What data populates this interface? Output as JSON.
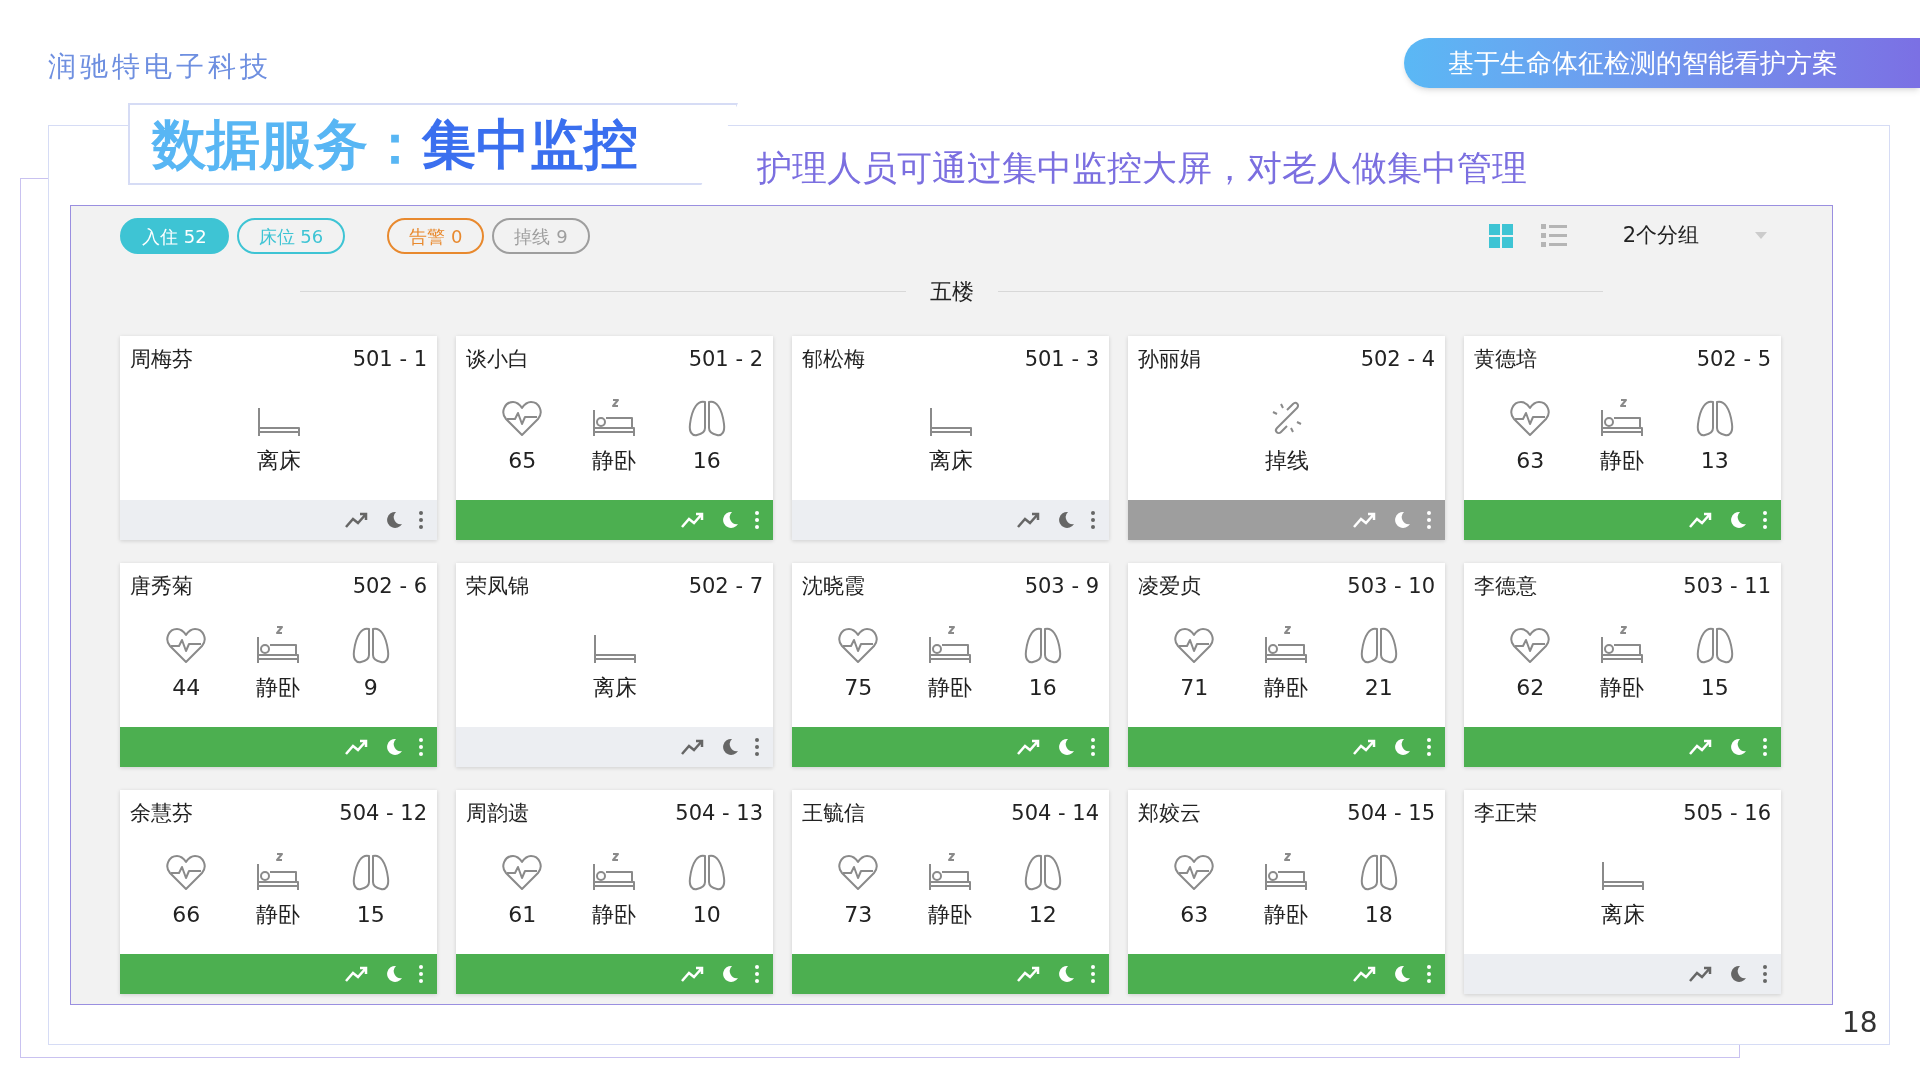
{
  "company": "润驰特电子科技",
  "banner": "基于生命体征检测的智能看护方案",
  "title": {
    "part_1": "数据服务：",
    "part_2": "集中监控"
  },
  "subtitle": "护理人员可通过集中监控大屏，对老人做集中管理",
  "filters": [
    {
      "label": "入住 52",
      "selected": true,
      "color": "#3ec4d4"
    },
    {
      "label": "床位 56",
      "selected": false,
      "color": "#3ec4d4"
    },
    {
      "label": "告警 0",
      "selected": false,
      "color": "#e8892e"
    },
    {
      "label": "掉线 9",
      "selected": false,
      "color": "#9e9e9e"
    }
  ],
  "views": [
    {
      "kind": "grid",
      "selected": true
    },
    {
      "kind": "list",
      "selected": false
    }
  ],
  "group_select": "2个分组",
  "floor": "五楼",
  "cards": [
    {
      "name": "周梅芬",
      "bed": "501 - 1",
      "kind": "off_bed",
      "label": "离床"
    },
    {
      "name": "谈小白",
      "bed": "501 - 2",
      "kind": "resting",
      "heart_rate": "65",
      "label": "静卧",
      "breath": "16"
    },
    {
      "name": "郁松梅",
      "bed": "501 - 3",
      "kind": "off_bed",
      "label": "离床"
    },
    {
      "name": "孙丽娟",
      "bed": "502 - 4",
      "kind": "offline",
      "label": "掉线"
    },
    {
      "name": "黄德培",
      "bed": "502 - 5",
      "kind": "resting",
      "heart_rate": "63",
      "label": "静卧",
      "breath": "13"
    },
    {
      "name": "唐秀菊",
      "bed": "502 - 6",
      "kind": "resting",
      "heart_rate": "44",
      "label": "静卧",
      "breath": "9"
    },
    {
      "name": "荣凤锦",
      "bed": "502 - 7",
      "kind": "off_bed",
      "label": "离床"
    },
    {
      "name": "沈晓霞",
      "bed": "503 - 9",
      "kind": "resting",
      "heart_rate": "75",
      "label": "静卧",
      "breath": "16"
    },
    {
      "name": "凌爱贞",
      "bed": "503 - 10",
      "kind": "resting",
      "heart_rate": "71",
      "label": "静卧",
      "breath": "21"
    },
    {
      "name": "李德意",
      "bed": "503 - 11",
      "kind": "resting",
      "heart_rate": "62",
      "label": "静卧",
      "breath": "15"
    },
    {
      "name": "余慧芬",
      "bed": "504 - 12",
      "kind": "resting",
      "heart_rate": "66",
      "label": "静卧",
      "breath": "15"
    },
    {
      "name": "周韵遗",
      "bed": "504 - 13",
      "kind": "resting",
      "heart_rate": "61",
      "label": "静卧",
      "breath": "10"
    },
    {
      "name": "王毓信",
      "bed": "504 - 14",
      "kind": "resting",
      "heart_rate": "73",
      "label": "静卧",
      "breath": "12"
    },
    {
      "name": "郑姣云",
      "bed": "504 - 15",
      "kind": "resting",
      "heart_rate": "63",
      "label": "静卧",
      "breath": "18"
    },
    {
      "name": "李正荣",
      "bed": "505 - 16",
      "kind": "off_bed",
      "label": "离床"
    }
  ],
  "page_number": "18"
}
